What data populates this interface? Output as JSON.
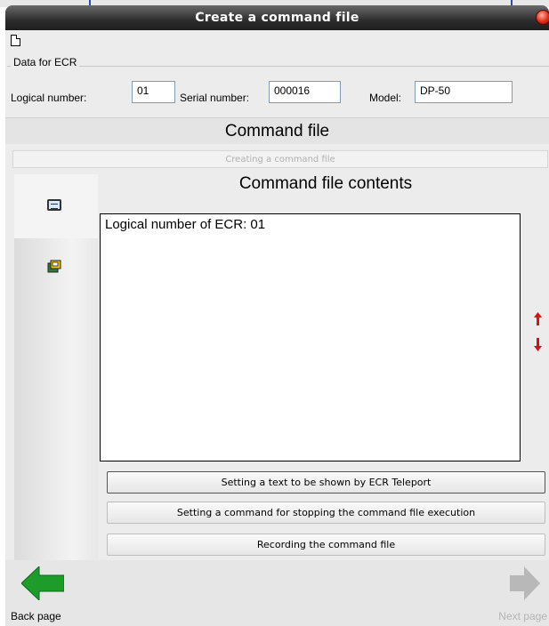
{
  "window": {
    "title": "Create a command file"
  },
  "ecr_group": {
    "legend": "Data for ECR",
    "logical_label": "Logical number:",
    "logical_value": "01",
    "serial_label": "Serial number:",
    "serial_value": "000016",
    "model_label": "Model:",
    "model_value": "DP-50"
  },
  "section": {
    "title": "Command file",
    "subtitle": "Creating a command file"
  },
  "sidebar": {
    "items": [
      {
        "icon": "command-file-icon"
      },
      {
        "icon": "ecr-device-icon"
      }
    ]
  },
  "contents": {
    "title": "Command file contents",
    "text": "Logical number of ECR: 01"
  },
  "scroll": {
    "up_icon": "arrow-up-icon",
    "down_icon": "arrow-down-icon"
  },
  "actions": [
    "Setting a text to be shown by ECR Teleport",
    "Setting a command for stopping the command file execution",
    "Recording the command file"
  ],
  "nav": {
    "back_label": "Back page",
    "next_label": "Next page"
  },
  "colors": {
    "back_arrow": "#1e9c2a",
    "next_arrow_disabled": "#b8b8b8",
    "scroll_arrows": "#d81010"
  }
}
